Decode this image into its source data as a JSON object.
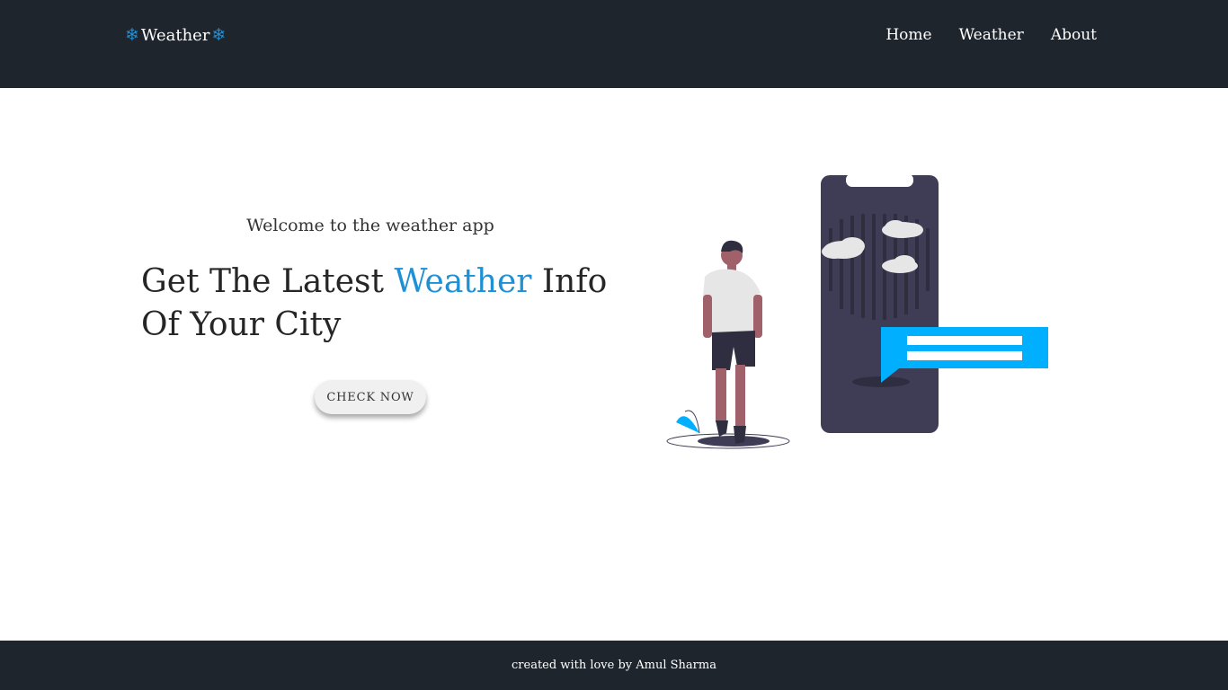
{
  "nav": {
    "brand": "Weather",
    "brand_icon": "snowflake-icon",
    "links": [
      "Home",
      "Weather",
      "About"
    ]
  },
  "hero": {
    "subtitle": "Welcome to the weather app",
    "title_part1": "Get The Latest ",
    "title_accent": "Weather",
    "title_part2": " Info Of Your City",
    "button": "CHECK NOW"
  },
  "footer": {
    "text": "created with love by Amul Sharma"
  },
  "colors": {
    "nav_bg": "#1f252d",
    "accent": "#1e90d6",
    "phone": "#3f3d56",
    "bubble": "#00b0ff"
  }
}
